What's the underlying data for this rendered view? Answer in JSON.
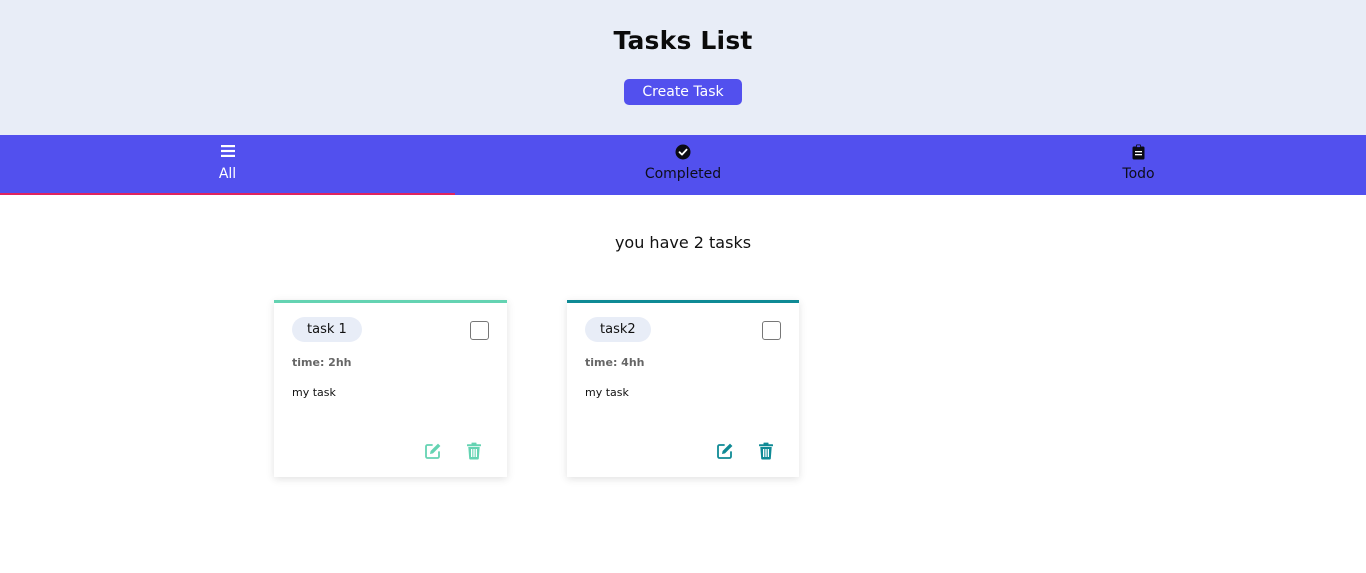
{
  "header": {
    "title": "Tasks List",
    "create_button": "Create Task"
  },
  "tabs": [
    {
      "label": "All",
      "icon": "list-icon"
    },
    {
      "label": "Completed",
      "icon": "check-circle-icon"
    },
    {
      "label": "Todo",
      "icon": "clipboard-icon"
    }
  ],
  "active_tab": "All",
  "summary": "you have 2 tasks",
  "tasks": [
    {
      "name": "task 1",
      "time": "time: 2hh",
      "description": "my task",
      "completed": false,
      "accent": "#64d3b2"
    },
    {
      "name": "task2",
      "time": "time: 4hh",
      "description": "my task",
      "completed": false,
      "accent": "#0f8a95"
    }
  ],
  "colors": {
    "primary": "#5250ee",
    "header_bg": "#e8edf7",
    "tab_indicator": "#e0245e"
  }
}
